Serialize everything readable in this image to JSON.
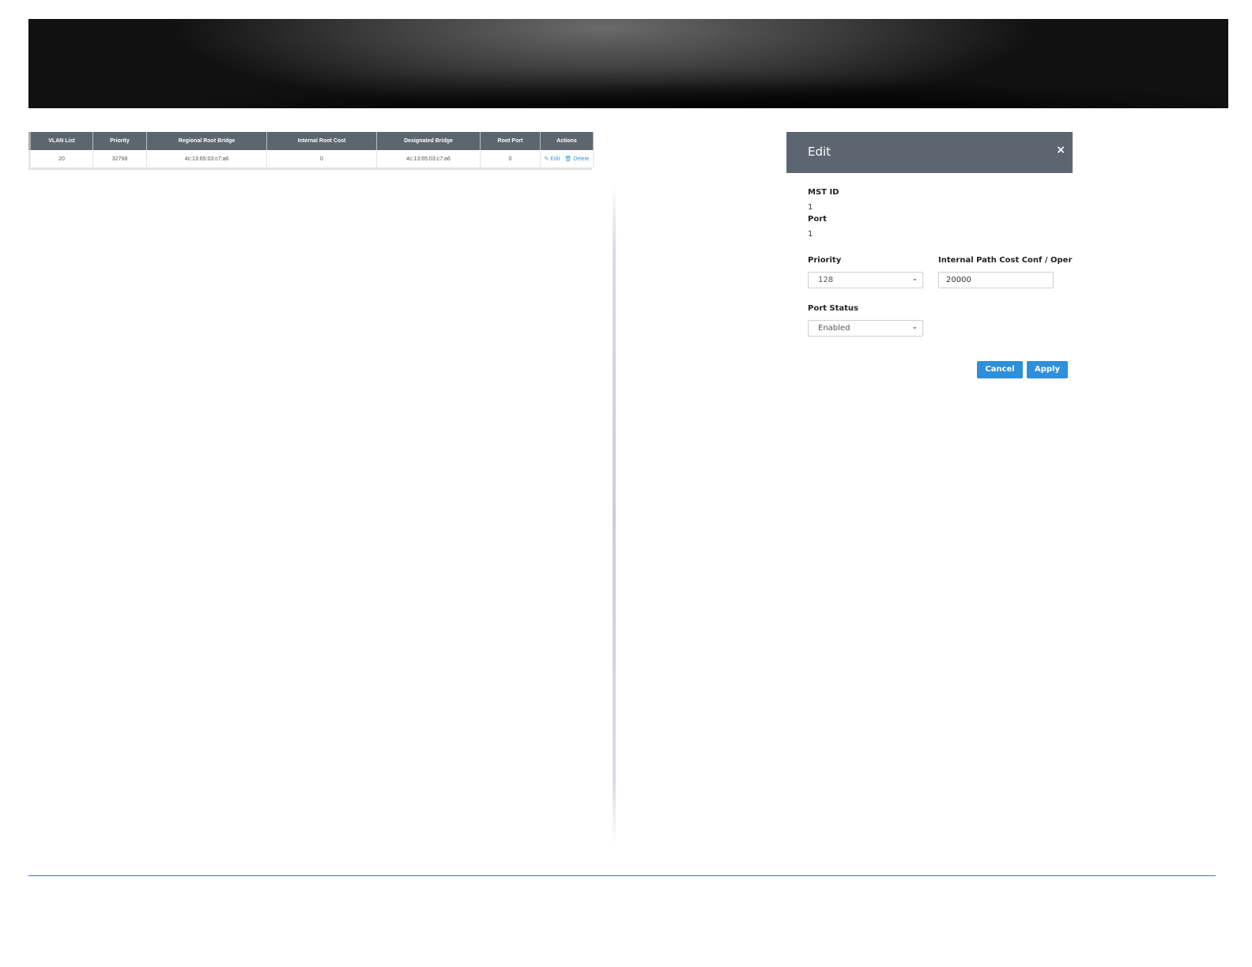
{
  "table": {
    "headers": [
      "VLAN List",
      "Priority",
      "Regional Root Bridge",
      "Internal Root Cost",
      "Designated Bridge",
      "Root Port",
      "Actions"
    ],
    "rows": [
      {
        "vlan_list": "20",
        "priority": "32768",
        "regional_root_bridge": "4c:13:65:03:c7:a6",
        "internal_root_cost": "0",
        "designated_bridge": "4c:13:65:03:c7:a6",
        "root_port": "0",
        "edit_label": "Edit",
        "delete_label": "Delete"
      }
    ]
  },
  "dialog": {
    "title": "Edit",
    "close_label": "×",
    "mst_id_label": "MST ID",
    "mst_id_value": "1",
    "port_label": "Port",
    "port_value": "1",
    "priority_label": "Priority",
    "priority_value": "128",
    "path_cost_label": "Internal Path Cost Conf / Oper",
    "path_cost_value": "20000",
    "port_status_label": "Port Status",
    "port_status_value": "Enabled",
    "cancel_label": "Cancel",
    "apply_label": "Apply"
  },
  "colors": {
    "header_bg": "#5d6670",
    "button_bg": "#2f8fd8",
    "link": "#3a9ad9",
    "footer_line": "#4a77b0"
  },
  "icons": {
    "edit": "edit-icon",
    "delete": "trash-icon",
    "close": "close-icon",
    "chevron": "chevron-down-icon"
  }
}
